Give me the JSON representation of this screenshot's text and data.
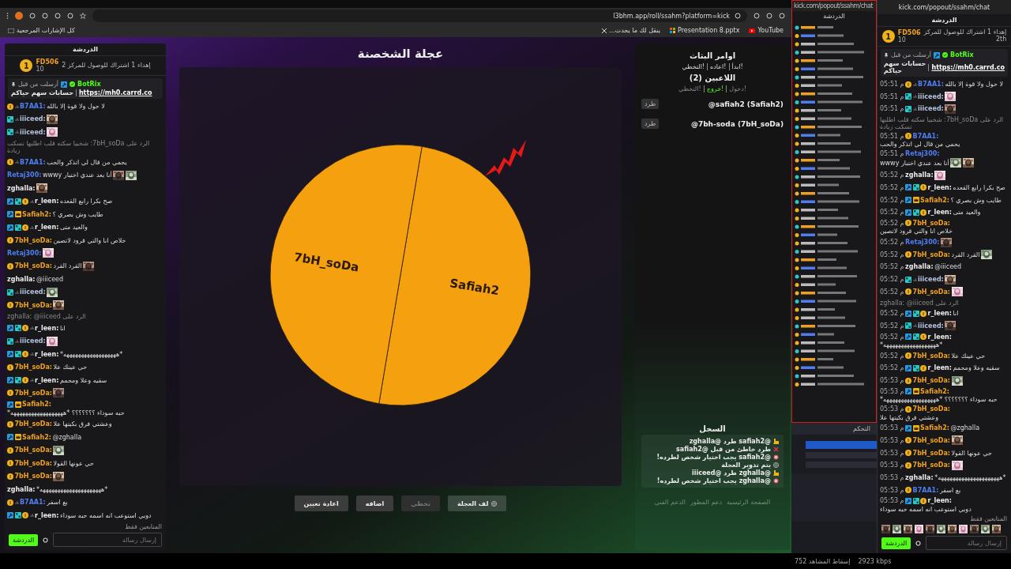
{
  "browser": {
    "address": "l3bhm.app/roll/ssahm?platform=kick",
    "bookmarks": [
      {
        "label": "YouTube",
        "kind": "youtube"
      },
      {
        "label": "Presentation 8.pptx",
        "kind": "office"
      },
      {
        "label": "ينقل لك ما يحدث...",
        "kind": "x"
      }
    ],
    "all_bookmarks": "كل الإشارات المرجعية"
  },
  "chat": {
    "title": "الدردشة",
    "leader": {
      "rank": "1",
      "name": "FD506",
      "count": "10",
      "goal": "إهداء 1 اشتراك للوصول للمركز 2"
    },
    "pinned": {
      "sent_by": "أرسلت من قبل",
      "bot": "BotRix",
      "text": "حسابات سهم حياكم",
      "link": "https://mh0.carrd.co"
    },
    "messages": [
      {
        "kind": "message",
        "badges": [
          {
            "kind": "sub"
          },
          {
            "kind": "slash"
          }
        ],
        "user": "B7AA1:",
        "color": "#4f7df0",
        "text": "لا حول ولا قوة إلا بالله"
      },
      {
        "kind": "message",
        "badges": [
          {
            "kind": "gift"
          },
          {
            "kind": "slash"
          }
        ],
        "user": "iiiceed:",
        "color": "#b4c2de",
        "emotes": [
          {
            "kind": "picture"
          }
        ]
      },
      {
        "kind": "message",
        "badges": [
          {
            "kind": "gift"
          },
          {
            "kind": "slash"
          }
        ],
        "user": "iiiceed:",
        "color": "#b4c2de",
        "emotes": [
          {
            "kind": "picture"
          }
        ]
      },
      {
        "kind": "reply",
        "text": "الرد على 7bH_soDa: شخبيا سكته قلب اطلبها تسكت زيادة"
      },
      {
        "kind": "message",
        "badges": [
          {
            "kind": "sub"
          },
          {
            "kind": "slash"
          }
        ],
        "user": "B7AA1:",
        "color": "#4f7df0",
        "text": "يحمي من قال لي اتذكر والحب"
      },
      {
        "kind": "message",
        "user": "Retaj300:",
        "color": "#4f7df0",
        "text": "أنا بعد عندي اختبار wwwy",
        "emotes": [
          {
            "kind": "picture"
          },
          {
            "kind": "picture"
          }
        ]
      },
      {
        "kind": "message",
        "user": "zghalla:",
        "color": "#ececec",
        "emotes": [
          {
            "kind": "picture"
          }
        ]
      },
      {
        "kind": "message",
        "badges": [
          {
            "kind": "mod"
          },
          {
            "kind": "gift"
          },
          {
            "kind": "sub"
          },
          {
            "kind": "slash"
          }
        ],
        "user": "r_leen:",
        "color": "#ececec",
        "text": "صح بكرا رابع القعده"
      },
      {
        "kind": "message",
        "badges": [
          {
            "kind": "mod"
          },
          {
            "kind": "crown"
          }
        ],
        "user": "Safiah2:",
        "color": "#f0a020",
        "text": "طايب وش بصري ؟"
      },
      {
        "kind": "message",
        "badges": [
          {
            "kind": "mod"
          },
          {
            "kind": "gift"
          },
          {
            "kind": "sub"
          },
          {
            "kind": "slash"
          }
        ],
        "user": "r_leen:",
        "color": "#ececec",
        "text": "والعيد متى"
      },
      {
        "kind": "message",
        "badges": [
          {
            "kind": "sub"
          }
        ],
        "user": "7bH_soDa:",
        "color": "#f0a020",
        "text": "خلاص انا والتي قرود لاتصين"
      },
      {
        "kind": "message",
        "user": "Retaj300:",
        "color": "#4f7df0",
        "emotes": [
          {
            "kind": "picture"
          }
        ]
      },
      {
        "kind": "message",
        "badges": [
          {
            "kind": "sub"
          }
        ],
        "user": "7bH_soDa:",
        "color": "#f0a020",
        "text": "القرد القرد",
        "emotes": [
          {
            "kind": "picture"
          }
        ]
      },
      {
        "kind": "message",
        "user": "zghalla:",
        "color": "#ececec",
        "text": "@iiiceed"
      },
      {
        "kind": "message",
        "badges": [
          {
            "kind": "gift"
          },
          {
            "kind": "slash"
          }
        ],
        "user": "iiiceed:",
        "color": "#b4c2de",
        "emotes": [
          {
            "kind": "picture"
          }
        ]
      },
      {
        "kind": "message",
        "badges": [
          {
            "kind": "sub"
          }
        ],
        "user": "7bH_soDa:",
        "color": "#f0a020",
        "emotes": [
          {
            "kind": "picture"
          }
        ]
      },
      {
        "kind": "reply",
        "text": "الرد على zghalla: @iiiceed"
      },
      {
        "kind": "message",
        "badges": [
          {
            "kind": "mod"
          },
          {
            "kind": "gift"
          },
          {
            "kind": "sub"
          },
          {
            "kind": "slash"
          }
        ],
        "user": "r_leen:",
        "color": "#ececec",
        "text": "انا"
      },
      {
        "kind": "message",
        "badges": [
          {
            "kind": "gift"
          },
          {
            "kind": "slash"
          }
        ],
        "user": "iiiceed:",
        "color": "#b4c2de",
        "emotes": [
          {
            "kind": "picture"
          }
        ]
      },
      {
        "kind": "message",
        "badges": [
          {
            "kind": "mod"
          },
          {
            "kind": "gift"
          },
          {
            "kind": "sub"
          },
          {
            "kind": "slash"
          }
        ],
        "user": "r_leen:",
        "color": "#ececec",
        "text": "*ههههههههههههههههههه*"
      },
      {
        "kind": "message",
        "badges": [
          {
            "kind": "sub"
          }
        ],
        "user": "7bH_soDa:",
        "color": "#f0a020",
        "text": "حي عينك علا"
      },
      {
        "kind": "message",
        "badges": [
          {
            "kind": "mod"
          },
          {
            "kind": "gift"
          },
          {
            "kind": "sub"
          },
          {
            "kind": "slash"
          }
        ],
        "user": "r_leen:",
        "color": "#ececec",
        "text": "سقيه وعلا ومحمم"
      },
      {
        "kind": "message",
        "badges": [
          {
            "kind": "sub"
          }
        ],
        "user": "7bH_soDa:",
        "color": "#f0a020",
        "emotes": [
          {
            "kind": "picture"
          }
        ]
      },
      {
        "kind": "message",
        "badges": [
          {
            "kind": "mod"
          },
          {
            "kind": "crown"
          }
        ],
        "user": "Safiah2:",
        "color": "#f0a020",
        "text": "حبه سوداء ؟؟؟؟؟؟؟ *ههههههههههههههههههه*"
      },
      {
        "kind": "message",
        "badges": [
          {
            "kind": "sub"
          }
        ],
        "user": "7bH_soDa:",
        "color": "#f0a020",
        "text": "وعشتي فرق بكيتها علا"
      },
      {
        "kind": "message",
        "badges": [
          {
            "kind": "mod"
          },
          {
            "kind": "crown"
          }
        ],
        "user": "Safiah2:",
        "color": "#f0a020",
        "text": "@zghalla"
      },
      {
        "kind": "message",
        "badges": [
          {
            "kind": "sub"
          }
        ],
        "user": "7bH_soDa:",
        "color": "#f0a020",
        "emotes": [
          {
            "kind": "picture"
          }
        ]
      },
      {
        "kind": "message",
        "badges": [
          {
            "kind": "sub"
          }
        ],
        "user": "7bH_soDa:",
        "color": "#f0a020",
        "text": "حي عونها القولا"
      },
      {
        "kind": "message",
        "badges": [
          {
            "kind": "sub"
          }
        ],
        "user": "7bH_soDa:",
        "color": "#f0a020",
        "emotes": [
          {
            "kind": "picture"
          }
        ]
      },
      {
        "kind": "message",
        "user": "zghalla:",
        "color": "#ececec",
        "text": "*هههههههههههههههههههههه*"
      },
      {
        "kind": "message",
        "badges": [
          {
            "kind": "sub"
          },
          {
            "kind": "slash"
          }
        ],
        "user": "B7AA1:",
        "color": "#4f7df0",
        "text": "بع اسفر"
      },
      {
        "kind": "message",
        "badges": [
          {
            "kind": "mod"
          },
          {
            "kind": "gift"
          },
          {
            "kind": "sub"
          },
          {
            "kind": "slash"
          }
        ],
        "user": "r_leen:",
        "color": "#ececec",
        "text": "دوبي استوعب انه اسمه حبه سوداء"
      }
    ],
    "followers_only": "المتابعين فقط",
    "input_placeholder": "إرسال رسالة",
    "send": "الدردشة"
  },
  "wheel": {
    "title": "عجلة الشخصنة",
    "segments": [
      {
        "label": "Safiah2"
      },
      {
        "label": "7bH_soDa"
      }
    ],
    "buttons": [
      {
        "label": "لف العجلة",
        "kind": "spin",
        "disabled": false
      },
      {
        "label": "تخطي",
        "kind": "plain",
        "disabled": true
      },
      {
        "label": "اضافه",
        "kind": "plain",
        "disabled": false
      },
      {
        "label": "اعادة تعيين",
        "kind": "plain",
        "disabled": false
      }
    ]
  },
  "side": {
    "commands_title": "اوامر البثاث",
    "commands": [
      {
        "label": "!ابدأ"
      },
      {
        "label": "!اعاده"
      },
      {
        "label": "!التخطي"
      }
    ],
    "players_title": "اللاعبين (2)",
    "player_commands": [
      {
        "label": "!دخول",
        "selected": false
      },
      {
        "label": "!خروج",
        "selected": true
      },
      {
        "label": "!التخطي",
        "selected": false
      }
    ],
    "players": [
      {
        "name": "@safiah2 (Safiah2)",
        "kick": "طرد"
      },
      {
        "name": "@7bh-soda (7bH_soDa)",
        "kick": "طرد"
      }
    ],
    "log_title": "السجل",
    "log": [
      {
        "kind": "kick",
        "text": "@safiah2 طرد @zghalla"
      },
      {
        "kind": "error",
        "text": "طرد خاطئ من قبل @safiah2"
      },
      {
        "kind": "target",
        "text": "@safiah2 يجب اختيار شخص لطرده!"
      },
      {
        "kind": "spin",
        "text": "يتم تدوير العجلة"
      },
      {
        "kind": "kick",
        "text": "@zghalla طرد @iiiceed"
      },
      {
        "kind": "target",
        "text": "@zghalla يجب اختيار شخص لطرده!"
      }
    ],
    "footer_links": [
      "الصفحة الرئيسية",
      "دعم المطور",
      "الدعم الفني"
    ]
  },
  "mini_window": {
    "address": "kick.com/popout/ssahm/chat",
    "title": "الدردشة",
    "control_title": "التحكم"
  },
  "status": {
    "dropped": "إسقاط المشاهد 752",
    "bitrate": "2923 kbps"
  },
  "popout": {
    "address": "kick.com/popout/ssahm/chat",
    "title": "الدردشة",
    "leader": {
      "rank": "1",
      "name": "FD506",
      "count": "10",
      "goal": "إهداء 1 اشتراك للوصول للمركز",
      "place": "2th"
    },
    "pinned": {
      "sent_by": "أرسلت من قبل",
      "bot": "BotRix",
      "text": "حسابات سهم حياكم",
      "link": "https://mh0.carrd.co"
    },
    "messages": [
      {
        "kind": "message",
        "time": "05:51 م",
        "badges": [
          {
            "kind": "sub"
          },
          {
            "kind": "slash"
          }
        ],
        "user": "B7AA1:",
        "color": "#4f7df0",
        "text": "لا حول ولا قوة إلا بالله"
      },
      {
        "kind": "message",
        "time": "05:51 م",
        "badges": [
          {
            "kind": "gift"
          },
          {
            "kind": "slash"
          }
        ],
        "user": "iiiceed:",
        "color": "#b4c2de",
        "emotes": [
          {
            "kind": "picture"
          }
        ]
      },
      {
        "kind": "message",
        "time": "05:51 م",
        "badges": [
          {
            "kind": "gift"
          },
          {
            "kind": "slash"
          }
        ],
        "user": "iiiceed:",
        "color": "#b4c2de",
        "emotes": [
          {
            "kind": "picture"
          }
        ]
      },
      {
        "kind": "reply",
        "text": "الرد على 7bH_soDa: شخبيا سكته قلب اطلبها تسكت زيادة"
      },
      {
        "kind": "message",
        "time": "05:51 م",
        "badges": [
          {
            "kind": "sub"
          }
        ],
        "user": "B7AA1:",
        "color": "#4f7df0",
        "text": "يحمي من قال لي اتذكر والحب"
      },
      {
        "kind": "message",
        "time": "05:51 م",
        "user": "Retaj300:",
        "color": "#4f7df0",
        "text": "أنا بعد عندي اختبار wwwy",
        "emotes": [
          {
            "kind": "picture"
          },
          {
            "kind": "picture"
          }
        ]
      },
      {
        "kind": "message",
        "time": "05:52 م",
        "user": "zghalla:",
        "color": "#ececec",
        "emotes": [
          {
            "kind": "picture"
          }
        ]
      },
      {
        "kind": "message",
        "time": "05:52 م",
        "badges": [
          {
            "kind": "mod"
          },
          {
            "kind": "gift"
          },
          {
            "kind": "sub"
          }
        ],
        "user": "r_leen:",
        "color": "#ececec",
        "text": "صح بكرا رابع القعده"
      },
      {
        "kind": "message",
        "time": "05:52 م",
        "badges": [
          {
            "kind": "mod"
          },
          {
            "kind": "crown"
          }
        ],
        "user": "Safiah2:",
        "color": "#f0a020",
        "text": "طايب وش بصري ؟"
      },
      {
        "kind": "message",
        "time": "05:52 م",
        "badges": [
          {
            "kind": "mod"
          },
          {
            "kind": "gift"
          },
          {
            "kind": "sub"
          }
        ],
        "user": "r_leen:",
        "color": "#ececec",
        "text": "والعيد متى"
      },
      {
        "kind": "message",
        "time": "05:52 م",
        "badges": [
          {
            "kind": "sub"
          }
        ],
        "user": "7bH_soDa:",
        "color": "#f0a020",
        "text": "خلاص انا والتي قرود لاتصين"
      },
      {
        "kind": "message",
        "time": "05:52 م",
        "user": "Retaj300:",
        "color": "#4f7df0",
        "emotes": [
          {
            "kind": "picture"
          }
        ]
      },
      {
        "kind": "message",
        "time": "05:52 م",
        "badges": [
          {
            "kind": "sub"
          }
        ],
        "user": "7bH_soDa:",
        "color": "#f0a020",
        "text": "القرد القرد",
        "emotes": [
          {
            "kind": "picture"
          }
        ]
      },
      {
        "kind": "message",
        "time": "05:52 م",
        "user": "zghalla:",
        "color": "#ececec",
        "text": "@iiiceed"
      },
      {
        "kind": "message",
        "time": "05:52 م",
        "badges": [
          {
            "kind": "gift"
          },
          {
            "kind": "slash"
          }
        ],
        "user": "iiiceed:",
        "color": "#b4c2de",
        "emotes": [
          {
            "kind": "picture"
          }
        ]
      },
      {
        "kind": "message",
        "time": "05:52 م",
        "badges": [
          {
            "kind": "sub"
          }
        ],
        "user": "7bH_soDa:",
        "color": "#f0a020",
        "emotes": [
          {
            "kind": "picture"
          }
        ]
      },
      {
        "kind": "reply",
        "text": "الرد على zghalla: @iiiceed"
      },
      {
        "kind": "message",
        "time": "05:52 م",
        "badges": [
          {
            "kind": "mod"
          },
          {
            "kind": "gift"
          },
          {
            "kind": "sub"
          }
        ],
        "user": "r_leen:",
        "color": "#ececec",
        "text": "انا"
      },
      {
        "kind": "message",
        "time": "05:52 م",
        "badges": [
          {
            "kind": "gift"
          },
          {
            "kind": "slash"
          }
        ],
        "user": "iiiceed:",
        "color": "#b4c2de",
        "emotes": [
          {
            "kind": "picture"
          }
        ]
      },
      {
        "kind": "message",
        "time": "05:52 م",
        "badges": [
          {
            "kind": "mod"
          },
          {
            "kind": "gift"
          },
          {
            "kind": "sub"
          }
        ],
        "user": "r_leen:",
        "color": "#ececec",
        "text": "*ههههههههههههههههههه*"
      },
      {
        "kind": "message",
        "time": "05:52 م",
        "badges": [
          {
            "kind": "sub"
          }
        ],
        "user": "7bH_soDa:",
        "color": "#f0a020",
        "text": "حي عينك علا"
      },
      {
        "kind": "message",
        "time": "05:52 م",
        "badges": [
          {
            "kind": "mod"
          },
          {
            "kind": "gift"
          },
          {
            "kind": "sub"
          }
        ],
        "user": "r_leen:",
        "color": "#ececec",
        "text": "سقيه وعلا ومحمم"
      },
      {
        "kind": "message",
        "time": "05:53 م",
        "badges": [
          {
            "kind": "sub"
          }
        ],
        "user": "7bH_soDa:",
        "color": "#f0a020",
        "emotes": [
          {
            "kind": "picture"
          }
        ]
      },
      {
        "kind": "message",
        "time": "05:53 م",
        "badges": [
          {
            "kind": "mod"
          },
          {
            "kind": "crown"
          }
        ],
        "user": "Safiah2:",
        "color": "#f0a020",
        "text": "حبه سوداء ؟؟؟؟؟؟؟ *ههههههههههههههههههه*"
      },
      {
        "kind": "message",
        "time": "05:53 م",
        "badges": [
          {
            "kind": "sub"
          }
        ],
        "user": "7bH_soDa:",
        "color": "#f0a020",
        "text": "وعشتي فرق بكيتها علا"
      },
      {
        "kind": "message",
        "time": "05:53 م",
        "badges": [
          {
            "kind": "mod"
          },
          {
            "kind": "crown"
          }
        ],
        "user": "Safiah2:",
        "color": "#f0a020",
        "text": "@zghalla"
      },
      {
        "kind": "message",
        "time": "05:53 م",
        "badges": [
          {
            "kind": "sub"
          }
        ],
        "user": "7bH_soDa:",
        "color": "#f0a020",
        "emotes": [
          {
            "kind": "picture"
          }
        ]
      },
      {
        "kind": "message",
        "time": "05:53 م",
        "badges": [
          {
            "kind": "sub"
          }
        ],
        "user": "7bH_soDa:",
        "color": "#f0a020",
        "text": "حي عونها القولا"
      },
      {
        "kind": "message",
        "time": "05:53 م",
        "badges": [
          {
            "kind": "sub"
          }
        ],
        "user": "7bH_soDa:",
        "color": "#f0a020",
        "emotes": [
          {
            "kind": "picture"
          }
        ]
      },
      {
        "kind": "message",
        "time": "05:53 م",
        "user": "zghalla:",
        "color": "#ececec",
        "text": "*هههههههههههههههههههههه*"
      },
      {
        "kind": "message",
        "time": "05:53 م",
        "badges": [
          {
            "kind": "sub"
          }
        ],
        "user": "B7AA1:",
        "color": "#4f7df0",
        "text": "بع اسفر"
      },
      {
        "kind": "message",
        "time": "05:53 م",
        "badges": [
          {
            "kind": "mod"
          },
          {
            "kind": "gift"
          },
          {
            "kind": "sub"
          }
        ],
        "user": "r_leen:",
        "color": "#ececec",
        "text": "دوبي استوعب انه اسمه حبه سوداء"
      }
    ],
    "followers_only": "المتابعين فقط",
    "emote_bar": [
      {
        "kind": "picture"
      },
      {
        "kind": "picture"
      },
      {
        "kind": "picture"
      },
      {
        "kind": "picture"
      },
      {
        "kind": "picture"
      },
      {
        "kind": "picture"
      },
      {
        "kind": "picture"
      },
      {
        "kind": "picture"
      },
      {
        "kind": "picture"
      },
      {
        "kind": "picture"
      },
      {
        "kind": "picture"
      }
    ],
    "input_placeholder": "إرسال رسالة",
    "send": "الدردشة"
  }
}
